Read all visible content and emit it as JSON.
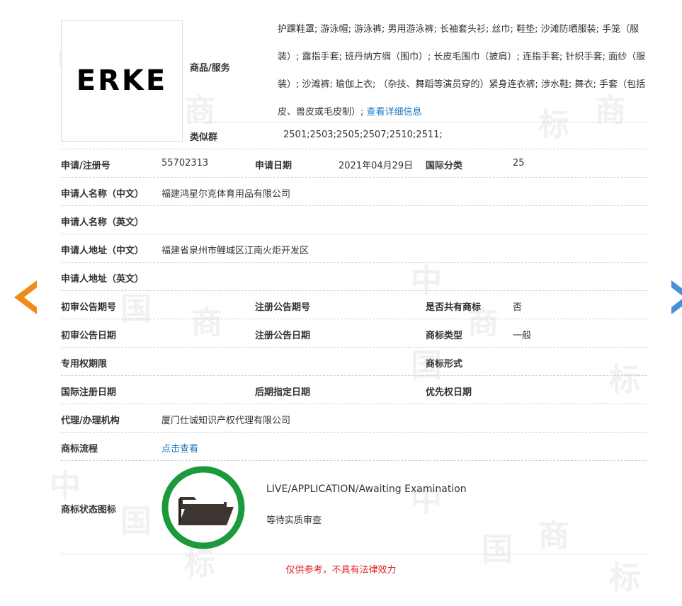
{
  "trademark": {
    "logo_text": "ERKE",
    "goods_label": "商品/服务",
    "goods_text": "护踝鞋罩; 游泳帽; 游泳裤; 男用游泳裤; 长袖套头衫; 丝巾; 鞋垫; 沙滩防晒服装; 手笼（服装）; 露指手套; 班丹纳方绸（围巾）; 长皮毛围巾（披肩）; 连指手套; 针织手套; 面纱（服装）; 沙滩裤; 瑜伽上衣; （杂技、舞蹈等演员穿的）紧身连衣裤; 涉水鞋; 舞衣; 手套（包括皮、兽皮或毛皮制）; ",
    "goods_link": "查看详细信息",
    "similar_group_label": "类似群",
    "similar_group_value": "2501;2503;2505;2507;2510;2511;"
  },
  "fields": {
    "reg_no_label": "申请/注册号",
    "reg_no_value": "55702313",
    "apply_date_label": "申请日期",
    "apply_date_value": "2021年04月29日",
    "intl_class_label": "国际分类",
    "intl_class_value": "25",
    "applicant_cn_label": "申请人名称（中文）",
    "applicant_cn_value": "福建鸿星尔克体育用品有限公司",
    "applicant_en_label": "申请人名称（英文）",
    "address_cn_label": "申请人地址（中文）",
    "address_cn_value": "福建省泉州市鲤城区江南火炬开发区",
    "address_en_label": "申请人地址（英文）",
    "prelim_pub_no_label": "初审公告期号",
    "reg_pub_no_label": "注册公告期号",
    "shared_label": "是否共有商标",
    "shared_value": "否",
    "prelim_pub_date_label": "初审公告日期",
    "reg_pub_date_label": "注册公告日期",
    "tm_type_label": "商标类型",
    "tm_type_value": "一般",
    "exclusive_period_label": "专用权期限",
    "tm_form_label": "商标形式",
    "intl_reg_date_label": "国际注册日期",
    "later_date_label": "后期指定日期",
    "priority_date_label": "优先权日期",
    "agent_label": "代理/办理机构",
    "agent_value": "厦门仕诚知识产权代理有限公司",
    "process_label": "商标流程",
    "process_link": "点击查看",
    "status_icon_label": "商标状态图标",
    "status_en": "LIVE/APPLICATION/Awaiting Examination",
    "status_cn": "等待实质审查"
  },
  "disclaimer": "仅供参考，不具有法律效力",
  "watermark_chars": [
    "中",
    "国",
    "商",
    "标"
  ],
  "colors": {
    "link": "#1a78c2",
    "status_ring": "#1a9a3c",
    "disclaimer": "#e02020",
    "prev_arrow": "#f08a1b",
    "next_arrow": "#4a90d9"
  },
  "icons": {
    "status": "folder-icon",
    "prev": "arrow-left-icon",
    "next": "arrow-right-icon"
  }
}
